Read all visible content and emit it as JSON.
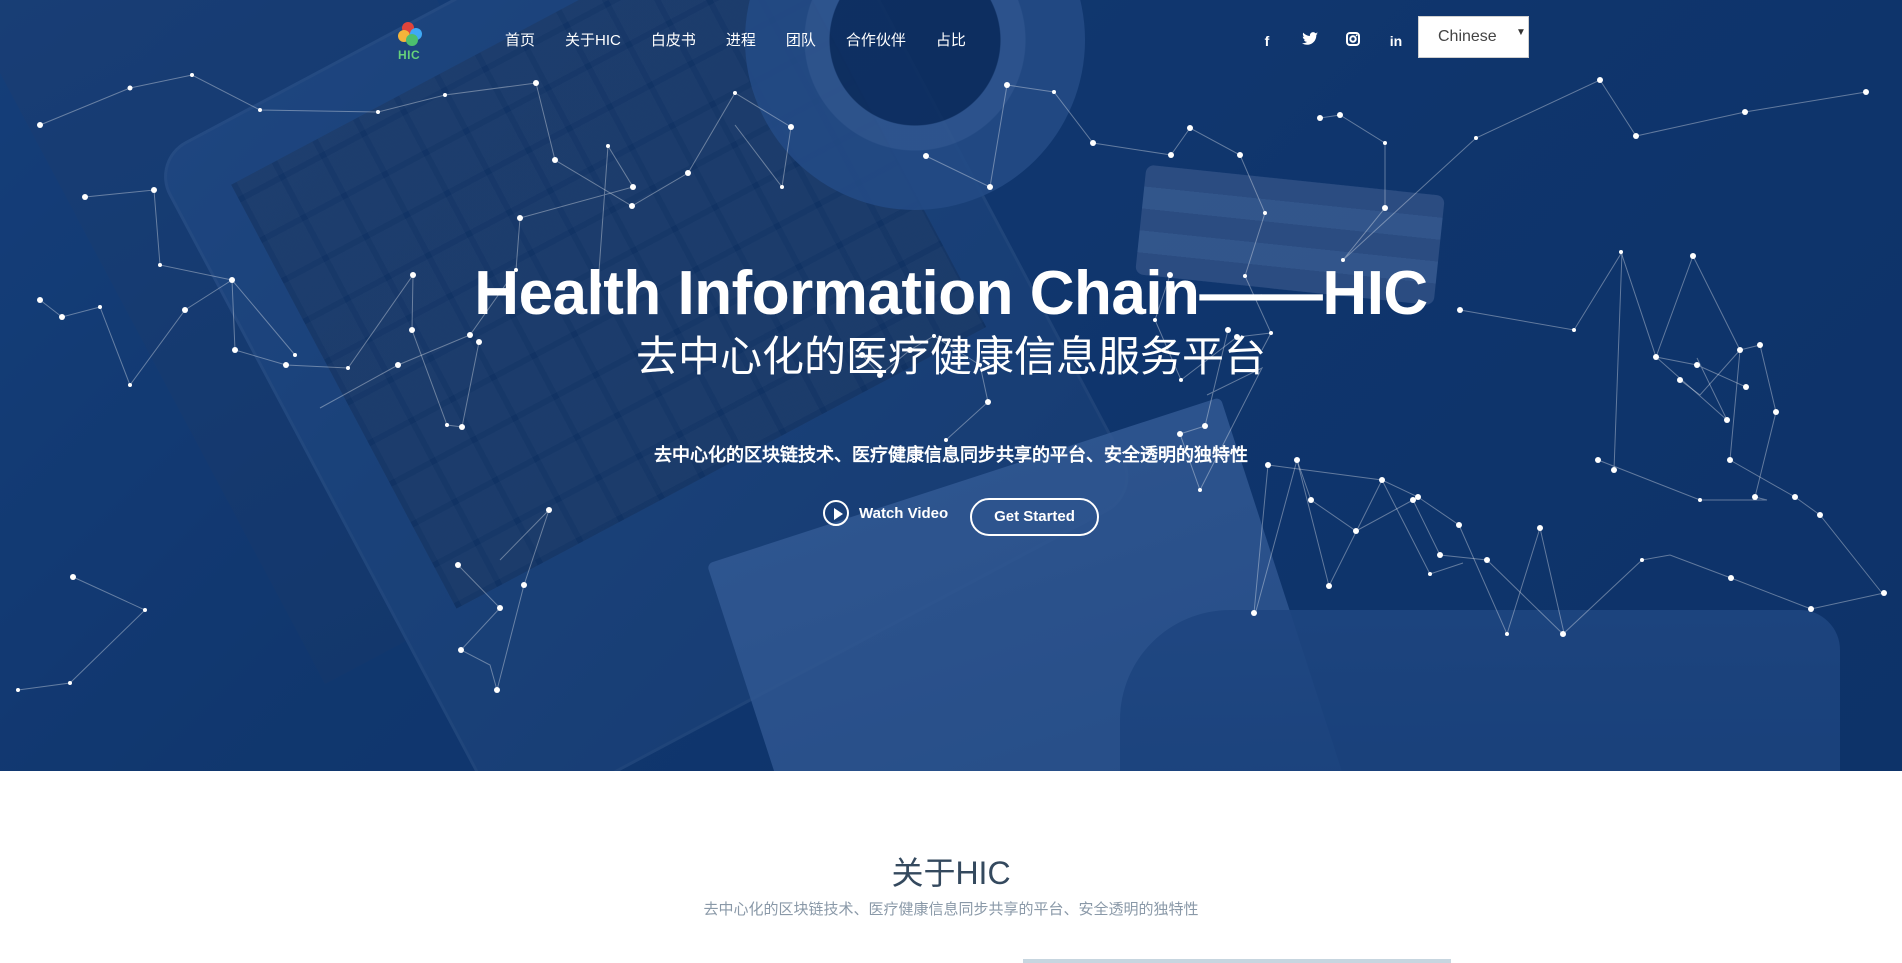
{
  "nav": {
    "logo_text": "HIC",
    "menu": [
      "首页",
      "关于HIC",
      "白皮书",
      "进程",
      "团队",
      "合作伙伴",
      "占比"
    ],
    "social": [
      {
        "icon": "facebook-icon",
        "glyph": "f"
      },
      {
        "icon": "twitter-icon",
        "glyph": "t"
      },
      {
        "icon": "instagram-icon",
        "glyph": "◎"
      },
      {
        "icon": "linkedin-icon",
        "glyph": "in"
      }
    ],
    "language": "Chinese"
  },
  "hero": {
    "title": "Health Information Chain——HIC",
    "subtitle": "去中心化的医疗健康信息服务平台",
    "tagline": "去中心化的区块链技术、医疗健康信息同步共享的平台、安全透明的独特性",
    "watch_video": "Watch Video",
    "get_started": "Get Started"
  },
  "about": {
    "title": "关于HIC",
    "subtitle": "去中心化的区块链技术、医疗健康信息同步共享的平台、安全透明的独特性"
  },
  "colors": {
    "hero_overlay": "#0d3168",
    "text_dark": "#34495e",
    "text_muted": "#8a99a8"
  }
}
